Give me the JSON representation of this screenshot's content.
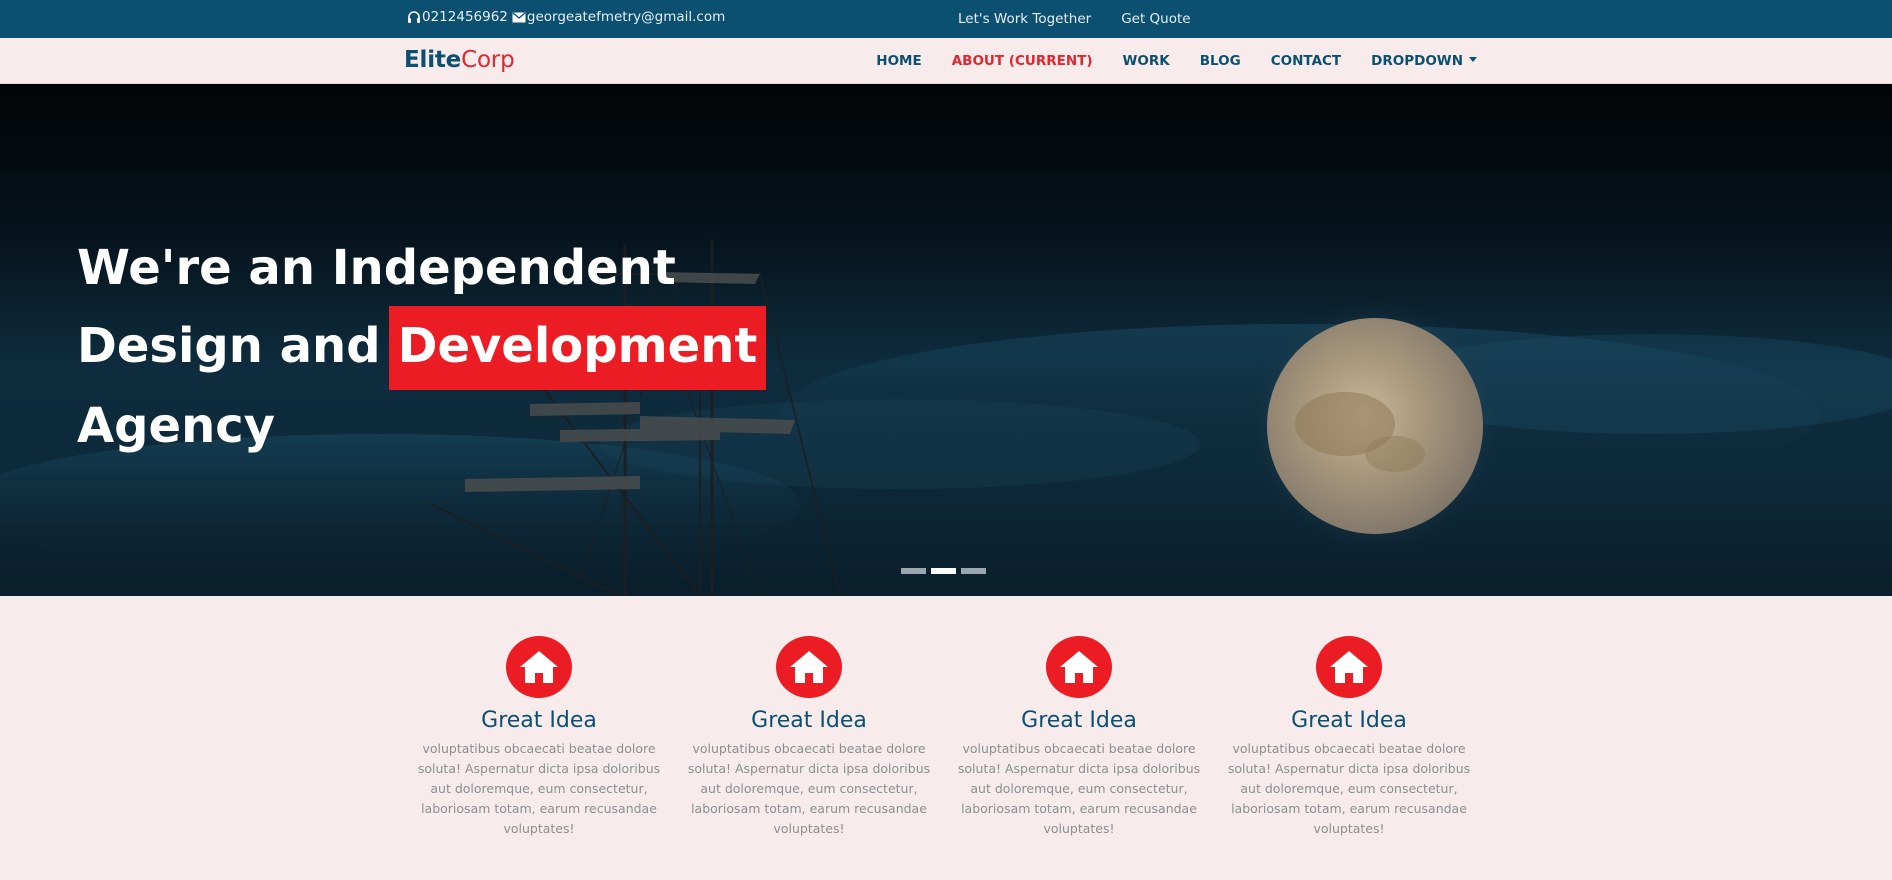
{
  "topbar": {
    "phone": "0212456962",
    "email": "georgeatefmetry@gmail.com",
    "phone_icon": "headset-icon",
    "email_icon": "envelope-icon",
    "links": [
      "Let's Work Together",
      "Get Quote"
    ]
  },
  "brand": {
    "part1": "Elite",
    "part2": "Corp"
  },
  "nav": {
    "items": [
      "HOME",
      "ABOUT (CURRENT)",
      "WORK",
      "BLOG",
      "CONTACT",
      "DROPDOWN"
    ],
    "active_index": 1
  },
  "hero": {
    "line1": "We're an Independent",
    "line2_prefix": "Design and",
    "line2_highlight": "Development",
    "line3": "Agency",
    "slides": 3,
    "active_slide": 2
  },
  "features": [
    {
      "icon": "home-icon",
      "title": "Great Idea",
      "text": "voluptatibus obcaecati beatae dolore soluta! Aspernatur dicta ipsa doloribus aut doloremque, eum consectetur, laboriosam totam, earum recusandae voluptates!"
    },
    {
      "icon": "home-icon",
      "title": "Great Idea",
      "text": "voluptatibus obcaecati beatae dolore soluta! Aspernatur dicta ipsa doloribus aut doloremque, eum consectetur, laboriosam totam, earum recusandae voluptates!"
    },
    {
      "icon": "home-icon",
      "title": "Great Idea",
      "text": "voluptatibus obcaecati beatae dolore soluta! Aspernatur dicta ipsa doloribus aut doloremque, eum consectetur, laboriosam totam, earum recusandae voluptates!"
    },
    {
      "icon": "home-icon",
      "title": "Great Idea",
      "text": "voluptatibus obcaecati beatae dolore soluta! Aspernatur dicta ipsa doloribus aut doloremque, eum consectetur, laboriosam totam, earum recusandae voluptates!"
    }
  ],
  "colors": {
    "primary": "#0b5070",
    "accent": "#ec1c24",
    "page_bg": "#f8ebeb"
  }
}
